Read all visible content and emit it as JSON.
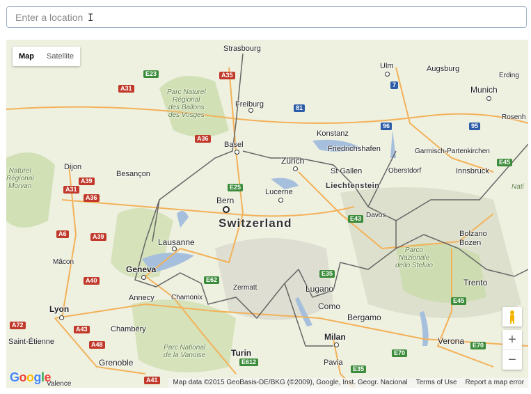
{
  "search": {
    "placeholder": "Enter a location"
  },
  "map_type": {
    "map_label": "Map",
    "satellite_label": "Satellite"
  },
  "cities": {
    "strasbourg": "Strasbourg",
    "ulm": "Ulm",
    "augsburg": "Augsburg",
    "erding": "Erding",
    "munich": "Munich",
    "rosenheim": "Rosenh",
    "freiburg": "Freiburg",
    "konstanz": "Konstanz",
    "friedrichshafen": "Friedrichshafen",
    "garmisch": "Garmisch-Partenkirchen",
    "basel": "Basel",
    "dijon": "Dijon",
    "zurich": "Zürich",
    "st_gallen": "St Gallen",
    "oberstdorf": "Oberstdorf",
    "innsbruck": "Innsbruck",
    "besancon": "Besançon",
    "lucerne": "Lucerne",
    "bern": "Bern",
    "davos": "Davos",
    "lausanne": "Lausanne",
    "bolzano": "Bolzano\nBozen",
    "macon": "Mâcon",
    "geneva": "Geneva",
    "zermatt": "Zermatt",
    "lugano": "Lugano",
    "trento": "Trento",
    "annecy": "Annecy",
    "chamonix": "Chamonix",
    "como": "Como",
    "lyon": "Lyon",
    "bergamo": "Bergamo",
    "chambery": "Chambéry",
    "saint_etienne": "Saint-Étienne",
    "milan": "Milan",
    "verona": "Verona",
    "grenoble": "Grenoble",
    "turin": "Turin",
    "pavia": "Pavia",
    "valence": "Valence"
  },
  "countries": {
    "switzerland": "Switzerland",
    "liechtenstein": "Liechtenstein"
  },
  "parks": {
    "ballons": "Parc Naturel\nRégional\ndes Ballons\ndes Vosges",
    "morvan": "Naturel\nRégional\nMorvan",
    "stelvio": "Parco\nNazionale\ndello Stelvio",
    "vanoise": "Parc National\nde la Vanoise",
    "nati": "Nati"
  },
  "shields": {
    "e23": "E23",
    "a35a": "A35",
    "a31a": "A31",
    "r81": "81",
    "r7": "7",
    "r96": "96",
    "r95": "95",
    "a36a": "A36",
    "a31b": "A31",
    "a39a": "A39",
    "a36b": "A36",
    "e25": "E25",
    "e43": "E43",
    "e45a": "E45",
    "a6": "A6",
    "a39b": "A39",
    "a40": "A40",
    "e62": "E62",
    "e35a": "E35",
    "a72": "A72",
    "a43": "A43",
    "a48": "A48",
    "e612": "E612",
    "e70a": "E70",
    "e70b": "E70",
    "e45b": "E45",
    "e35b": "E35",
    "a41": "A41"
  },
  "footer": {
    "attribution": "Map data ©2015 GeoBasis-DE/BKG (©2009), Google, Inst. Geogr. Nacional",
    "terms": "Terms of Use",
    "report": "Report a map error"
  },
  "logo": "Google",
  "colors": {
    "water": "#a5bfdd",
    "land": "#eef0e0",
    "forest": "#cbdcaa",
    "road_major": "#f3b158",
    "border": "#666666"
  }
}
